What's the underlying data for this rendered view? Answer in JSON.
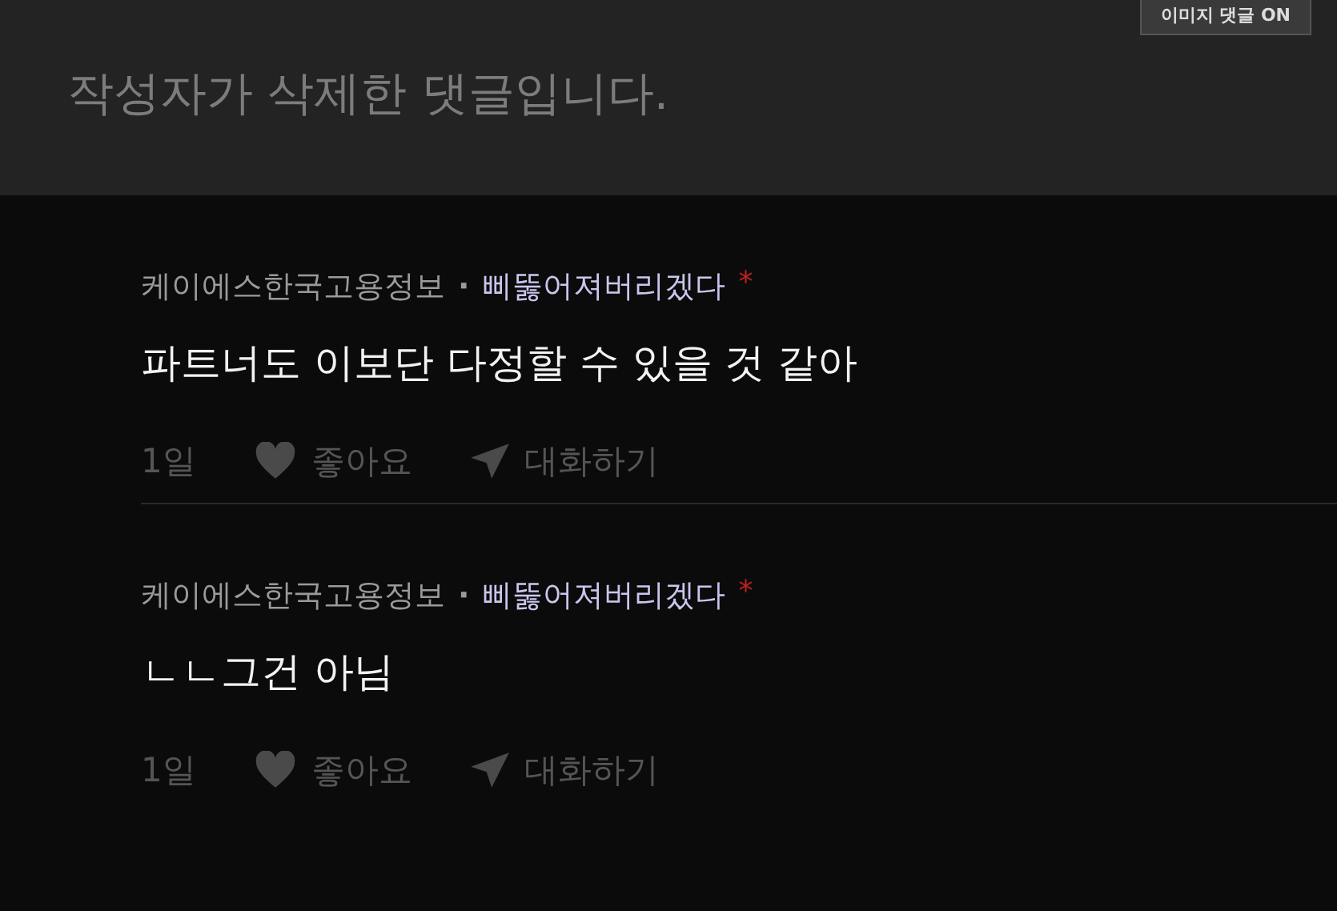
{
  "toggle": {
    "label": "이미지 댓글 ON"
  },
  "deleted_comment": {
    "text": "작성자가 삭제한 댓글입니다."
  },
  "replies": [
    {
      "author": "케이에스한국고용정보",
      "separator": "·",
      "nickname": "삐뚫어져버리겠다",
      "badge": "*",
      "text": "파트너도 이보단 다정할 수 있을 것 같아",
      "time": "1일",
      "like_label": "좋아요",
      "reply_label": "대화하기"
    },
    {
      "author": "케이에스한국고용정보",
      "separator": "·",
      "nickname": "삐뚫어져버리겠다",
      "badge": "*",
      "text": "ㄴㄴ그건 아님",
      "time": "1일",
      "like_label": "좋아요",
      "reply_label": "대화하기"
    }
  ]
}
